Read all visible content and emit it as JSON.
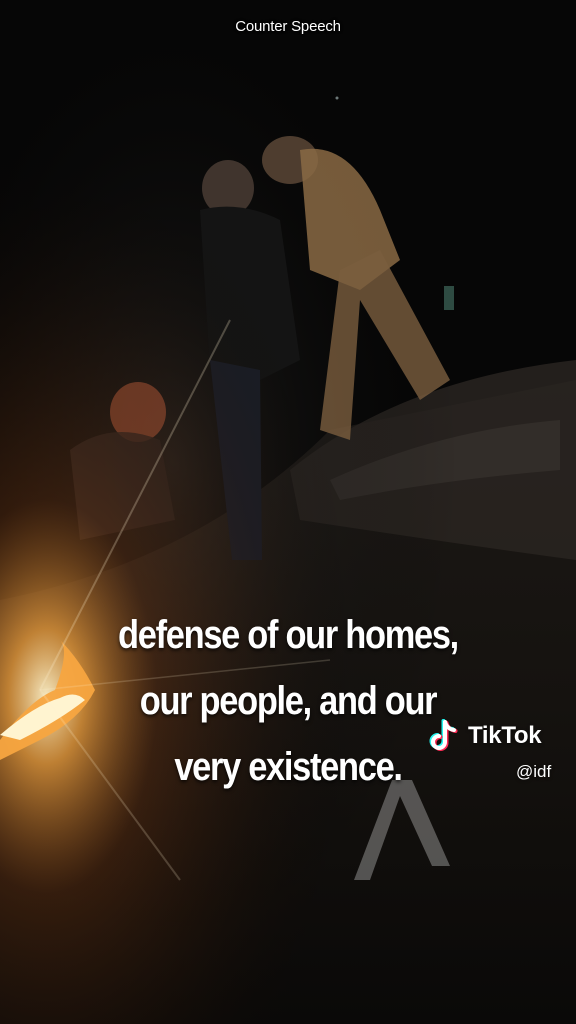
{
  "header": {
    "label": "Counter Speech"
  },
  "caption": {
    "lines": [
      "defense of our homes,",
      "our people, and our",
      "very existence."
    ]
  },
  "watermark": {
    "icon": "tiktok-logo-icon",
    "brand": "TikTok",
    "handle": "@idf"
  },
  "colors": {
    "background": "#060606",
    "fire": "#f7a540",
    "text": "#ffffff",
    "tiktok_cyan": "#25f4ee",
    "tiktok_red": "#fe2c55"
  }
}
